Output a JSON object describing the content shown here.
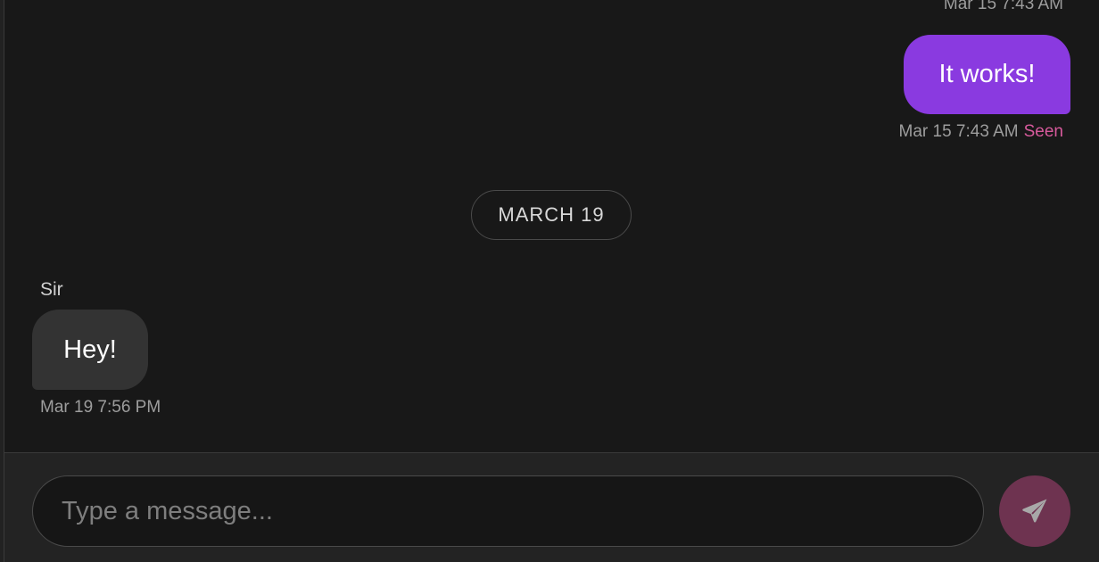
{
  "messages": [
    {
      "direction": "outgoing",
      "timestamp_top": "Mar 15 7:43 AM"
    },
    {
      "direction": "outgoing",
      "text": "It works!",
      "timestamp": "Mar 15 7:43 AM",
      "status": "Seen"
    },
    {
      "direction": "incoming",
      "sender": "Sir",
      "text": "Hey!",
      "timestamp": "Mar 19 7:56 PM"
    }
  ],
  "date_divider": "MARCH 19",
  "composer": {
    "placeholder": "Type a message...",
    "send_icon": "send-icon"
  },
  "colors": {
    "background": "#181818",
    "outgoing_bubble": "#8a3ae0",
    "incoming_bubble": "#333333",
    "seen": "#d75a9c",
    "send_button": "#6e3350"
  }
}
